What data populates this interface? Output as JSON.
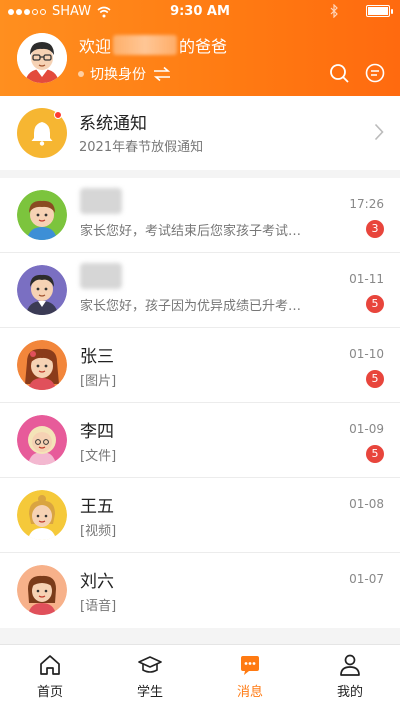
{
  "status_bar": {
    "carrier": "SHAW",
    "time": "9:30 AM"
  },
  "header": {
    "welcome_prefix": "欢迎",
    "welcome_suffix": "的爸爸",
    "switch_role_label": "切换身份"
  },
  "notice": {
    "title": "系统通知",
    "subtitle": "2021年春节放假通知"
  },
  "messages": [
    {
      "name": "",
      "preview": "家长您好，考试结束后您家孩子考试…",
      "time": "17:26",
      "badge": "3",
      "avatar": "boy-green-icon"
    },
    {
      "name": "",
      "preview": "家长您好，孩子因为优异成绩已升考…",
      "time": "01-11",
      "badge": "5",
      "avatar": "man-purple-icon"
    },
    {
      "name": "张三",
      "preview": "[图片]",
      "time": "01-10",
      "badge": "5",
      "avatar": "girl-orange-icon"
    },
    {
      "name": "李四",
      "preview": "[文件]",
      "time": "01-09",
      "badge": "5",
      "avatar": "grandma-pink-icon"
    },
    {
      "name": "王五",
      "preview": "[视频]",
      "time": "01-08",
      "badge": "",
      "avatar": "girl-yellow-icon"
    },
    {
      "name": "刘六",
      "preview": "[语音]",
      "time": "01-07",
      "badge": "",
      "avatar": "girl-peach-icon"
    }
  ],
  "tabs": [
    {
      "label": "首页",
      "icon": "home-icon"
    },
    {
      "label": "学生",
      "icon": "graduation-cap-icon"
    },
    {
      "label": "消息",
      "icon": "chat-bubble-icon",
      "active": true
    },
    {
      "label": "我的",
      "icon": "person-icon"
    }
  ],
  "colors": {
    "accent": "#ff7a12",
    "badge": "#e8453c",
    "bell": "#f6b632"
  }
}
